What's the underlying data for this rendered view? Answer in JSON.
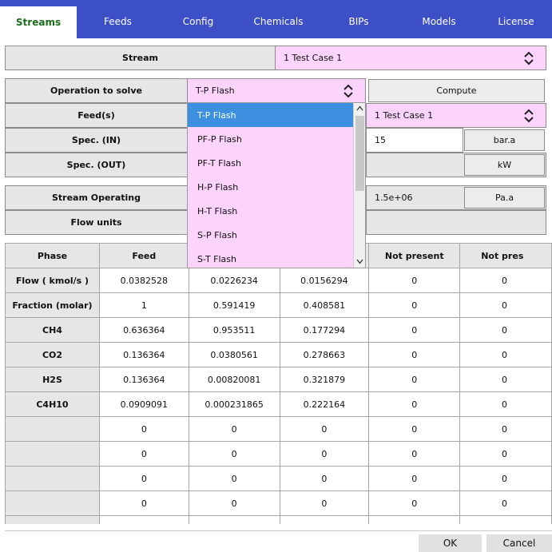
{
  "tabs": [
    "Streams",
    "Feeds",
    "Config",
    "Chemicals",
    "BIPs",
    "Models",
    "License"
  ],
  "stream": {
    "label": "Stream",
    "value": "1  Test Case 1"
  },
  "operation": {
    "label": "Operation to solve",
    "value": "T-P Flash",
    "compute": "Compute"
  },
  "feeds": {
    "label": "Feed(s)",
    "value": "1  Test Case 1"
  },
  "spec_in": {
    "label": "Spec. (IN)",
    "value": "15",
    "unit": "bar.a"
  },
  "spec_out": {
    "label": "Spec. (OUT)",
    "unit": "kW"
  },
  "stream_operating": {
    "label": "Stream Operating",
    "value": "1.5e+06",
    "unit": "Pa.a"
  },
  "flow_units": {
    "label": "Flow units"
  },
  "dropdown": {
    "options": [
      "T-P Flash",
      "PF-P Flash",
      "PF-T Flash",
      "H-P Flash",
      "H-T Flash",
      "S-P Flash",
      "S-T Flash"
    ],
    "selected": 0
  },
  "table": {
    "headers": [
      "Phase",
      "Feed",
      "",
      "",
      "Not present",
      "Not pres"
    ],
    "rows": [
      {
        "label": "Flow ( kmol/s )",
        "cells": [
          "0.0382528",
          "0.0226234",
          "0.0156294",
          "0",
          "0"
        ]
      },
      {
        "label": "Fraction (molar)",
        "cells": [
          "1",
          "0.591419",
          "0.408581",
          "0",
          "0"
        ]
      },
      {
        "label": "CH4",
        "cells": [
          "0.636364",
          "0.953511",
          "0.177294",
          "0",
          "0"
        ]
      },
      {
        "label": "CO2",
        "cells": [
          "0.136364",
          "0.0380561",
          "0.278663",
          "0",
          "0"
        ]
      },
      {
        "label": "H2S",
        "cells": [
          "0.136364",
          "0.00820081",
          "0.321879",
          "0",
          "0"
        ]
      },
      {
        "label": "C4H10",
        "cells": [
          "0.0909091",
          "0.000231865",
          "0.222164",
          "0",
          "0"
        ]
      },
      {
        "label": "",
        "cells": [
          "0",
          "0",
          "0",
          "0",
          "0"
        ]
      },
      {
        "label": "",
        "cells": [
          "0",
          "0",
          "0",
          "0",
          "0"
        ]
      },
      {
        "label": "",
        "cells": [
          "0",
          "0",
          "0",
          "0",
          "0"
        ]
      },
      {
        "label": "",
        "cells": [
          "0",
          "0",
          "0",
          "0",
          "0"
        ]
      }
    ]
  },
  "footer": {
    "ok": "OK",
    "cancel": "Cancel"
  },
  "colors": {
    "tab_bar": "#3c4fc6",
    "active_tab_text": "#1a6e1a",
    "pink": "#fbd3fb",
    "selected": "#3d8fe0"
  }
}
